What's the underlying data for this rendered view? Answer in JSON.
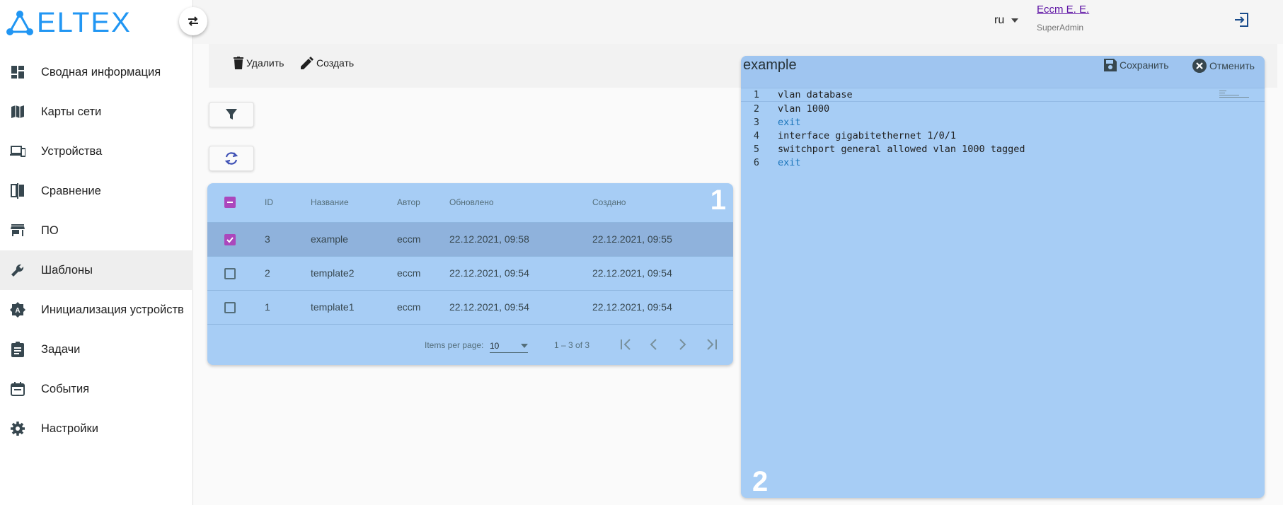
{
  "brand": {
    "logo_text": "ELTEX",
    "accent": "#2196f3"
  },
  "sidebar": {
    "items": [
      {
        "label": "Сводная информация",
        "icon": "dashboard-icon"
      },
      {
        "label": "Карты сети",
        "icon": "map-icon"
      },
      {
        "label": "Устройства",
        "icon": "devices-icon"
      },
      {
        "label": "Сравнение",
        "icon": "compare-icon"
      },
      {
        "label": "ПО",
        "icon": "store-icon"
      },
      {
        "label": "Шаблоны",
        "icon": "wrench-icon",
        "active": true
      },
      {
        "label": "Инициализация устройств",
        "icon": "auto-init-icon"
      },
      {
        "label": "Задачи",
        "icon": "assignment-icon"
      },
      {
        "label": "События",
        "icon": "event-icon"
      },
      {
        "label": "Настройки",
        "icon": "gear-icon"
      }
    ]
  },
  "header": {
    "lang": "ru",
    "user_name": "Eccm E. E.",
    "user_role": "SuperAdmin"
  },
  "toolbar": {
    "delete_label": "Удалить",
    "create_label": "Создать"
  },
  "table": {
    "columns": [
      "ID",
      "Название",
      "Автор",
      "Обновлено",
      "Создано"
    ],
    "rows": [
      {
        "id": "3",
        "name": "example",
        "author": "eccm",
        "updated": "22.12.2021, 09:58",
        "created": "22.12.2021, 09:55",
        "checked": true
      },
      {
        "id": "2",
        "name": "template2",
        "author": "eccm",
        "updated": "22.12.2021, 09:54",
        "created": "22.12.2021, 09:54",
        "checked": false
      },
      {
        "id": "1",
        "name": "template1",
        "author": "eccm",
        "updated": "22.12.2021, 09:54",
        "created": "22.12.2021, 09:54",
        "checked": false
      }
    ],
    "items_per_page_label": "Items per page:",
    "items_per_page": "10",
    "range_label": "1 – 3 of 3",
    "badge": "1"
  },
  "editor": {
    "title": "example",
    "save_label": "Сохранить",
    "cancel_label": "Отменить",
    "badge": "2",
    "lines": [
      {
        "n": "1",
        "text": "vlan database"
      },
      {
        "n": "2",
        "text": "vlan 1000"
      },
      {
        "n": "3",
        "text": "exit"
      },
      {
        "n": "4",
        "text": "interface gigabitethernet 1/0/1"
      },
      {
        "n": "5",
        "text": "switchport general allowed vlan 1000 tagged"
      },
      {
        "n": "6",
        "text": "exit"
      }
    ]
  }
}
